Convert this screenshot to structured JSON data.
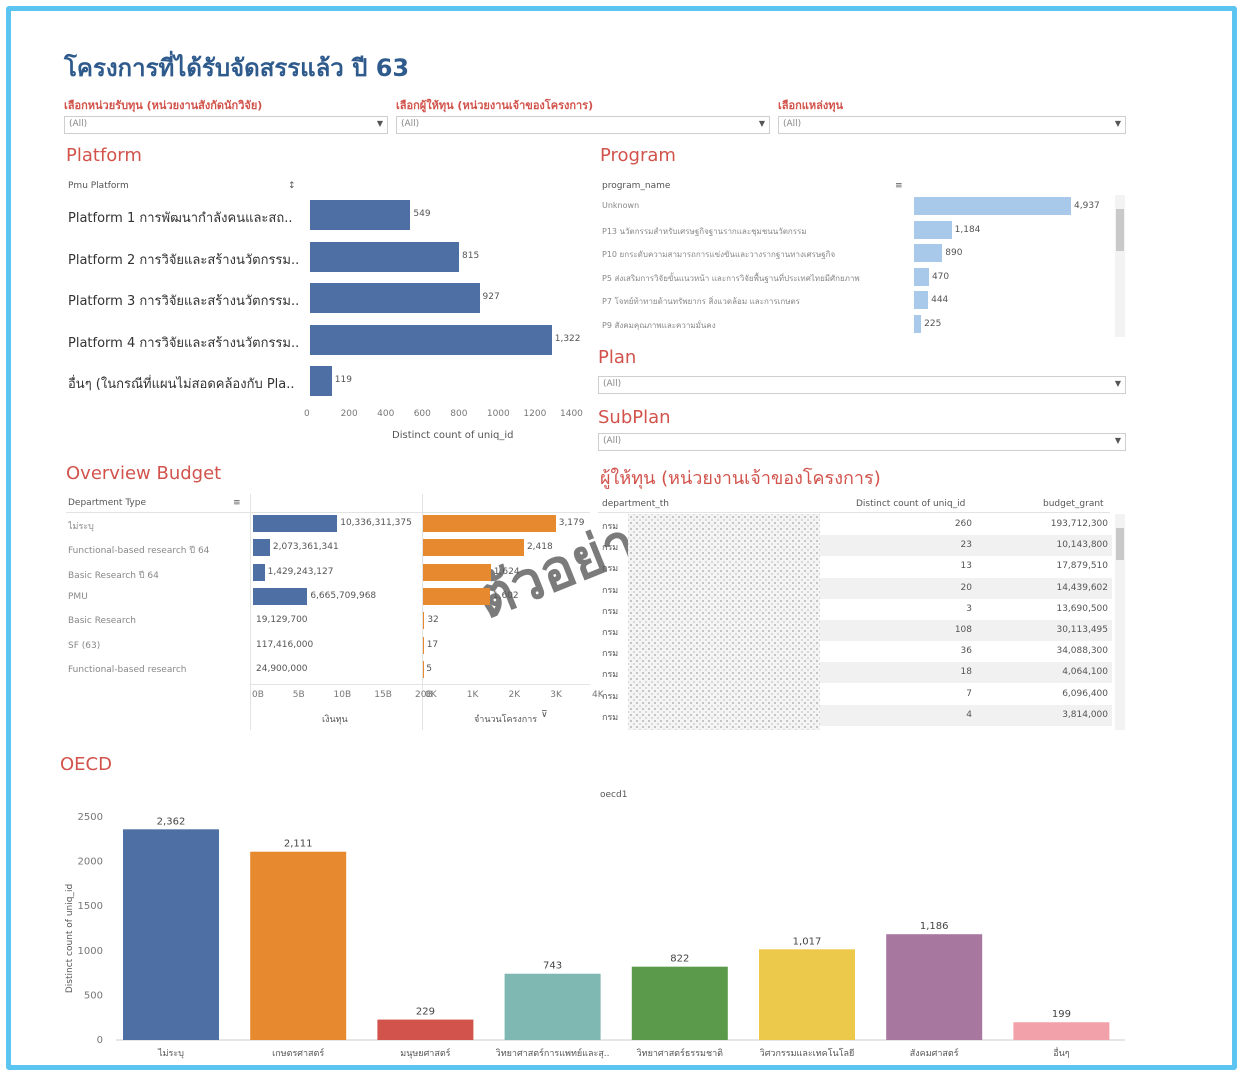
{
  "title": "โครงการที่ได้รับจัดสรรแล้ว ปี 63",
  "filters": [
    {
      "label": "เลือกหน่วยรับทุน (หน่วยงานสังกัดนักวิจัย)",
      "value": "(All)"
    },
    {
      "label": "เลือกผู้ให้ทุน (หน่วยงานเจ้าของโครงการ)",
      "value": "(All)"
    },
    {
      "label": "เลือกแหล่งทุน",
      "value": "(All)"
    }
  ],
  "platform": {
    "title": "Platform",
    "header": "Pmu Platform",
    "x_axis_label": "Distinct count of uniq_id",
    "ticks": [
      "0",
      "200",
      "400",
      "600",
      "800",
      "1000",
      "1200",
      "1400"
    ],
    "rows": [
      {
        "label": "Platform 1 การพัฒนากำลังคนและสถ..",
        "value": 549,
        "value_label": "549"
      },
      {
        "label": "Platform 2 การวิจัยและสร้างนวัตกรรม..",
        "value": 815,
        "value_label": "815"
      },
      {
        "label": "Platform 3 การวิจัยและสร้างนวัตกรรม..",
        "value": 927,
        "value_label": "927"
      },
      {
        "label": "Platform 4 การวิจัยและสร้างนวัตกรรม..",
        "value": 1322,
        "value_label": "1,322"
      },
      {
        "label": "อื่นๆ (ในกรณีที่แผนไม่สอดคล้องกับ Pla..",
        "value": 119,
        "value_label": "119"
      }
    ]
  },
  "program": {
    "title": "Program",
    "header": "program_name",
    "rows": [
      {
        "label": "Unknown",
        "value": 4937,
        "value_label": "4,937"
      },
      {
        "label": "P13 นวัตกรรมสำหรับเศรษฐกิจฐานรากและชุมชนนวัตกรรม",
        "value": 1184,
        "value_label": "1,184"
      },
      {
        "label": "P10 ยกระดับความสามารถการแข่งขันและวางรากฐานทางเศรษฐกิจ",
        "value": 890,
        "value_label": "890"
      },
      {
        "label": "P5 ส่งเสริมการวิจัยขั้นแนวหน้า และการวิจัยพื้นฐานที่ประเทศไทยมีศักยภาพ",
        "value": 470,
        "value_label": "470"
      },
      {
        "label": "P7 โจทย์ท้าทายด้านทรัพยากร สิ่งแวดล้อม และการเกษตร",
        "value": 444,
        "value_label": "444"
      },
      {
        "label": "P9 สังคมคุณภาพและความมั่นคง",
        "value": 225,
        "value_label": "225"
      }
    ]
  },
  "plan": {
    "title": "Plan",
    "value": "(All)"
  },
  "subplan": {
    "title": "SubPlan",
    "value": "(All)"
  },
  "overview": {
    "title": "Overview Budget",
    "header": "Department Type",
    "budget_axis_label": "เงินทุน",
    "count_axis_label": "จำนวนโครงการ",
    "budget_ticks": [
      "0B",
      "5B",
      "10B",
      "15B",
      "20B"
    ],
    "count_ticks": [
      "0K",
      "1K",
      "2K",
      "3K",
      "4K"
    ],
    "rows": [
      {
        "label": "ไม่ระบุ",
        "budget": 10336311375,
        "budget_label": "10,336,311,375",
        "count": 3179,
        "count_label": "3,179"
      },
      {
        "label": "Functional-based research ปี 64",
        "budget": 2073361341,
        "budget_label": "2,073,361,341",
        "count": 2418,
        "count_label": "2,418"
      },
      {
        "label": "Basic Research ปี 64",
        "budget": 1429243127,
        "budget_label": "1,429,243,127",
        "count": 1624,
        "count_label": "1,624"
      },
      {
        "label": "PMU",
        "budget": 6665709968,
        "budget_label": "6,665,709,968",
        "count": 1602,
        "count_label": "1,602"
      },
      {
        "label": "Basic Research",
        "budget": 19129700,
        "budget_label": "19,129,700",
        "count": 32,
        "count_label": "32"
      },
      {
        "label": "SF (63)",
        "budget": 117416000,
        "budget_label": "117,416,000",
        "count": 17,
        "count_label": "17"
      },
      {
        "label": "Functional-based research",
        "budget": 24900000,
        "budget_label": "24,900,000",
        "count": 5,
        "count_label": "5"
      }
    ]
  },
  "funders": {
    "title": "ผู้ให้ทุน (หน่วยงานเจ้าของโครงการ)",
    "headers": [
      "department_th",
      "Distinct count of uniq_id",
      "budget_grant"
    ],
    "rows": [
      {
        "dept": "กรม",
        "count": "260",
        "budget": "193,712,300"
      },
      {
        "dept": "กรม",
        "count": "23",
        "budget": "10,143,800"
      },
      {
        "dept": "กรม",
        "count": "13",
        "budget": "17,879,510"
      },
      {
        "dept": "กรม",
        "count": "20",
        "budget": "14,439,602"
      },
      {
        "dept": "กรม",
        "count": "3",
        "budget": "13,690,500"
      },
      {
        "dept": "กรม",
        "count": "108",
        "budget": "30,113,495"
      },
      {
        "dept": "กรม",
        "count": "36",
        "budget": "34,088,300"
      },
      {
        "dept": "กรม",
        "count": "18",
        "budget": "4,064,100"
      },
      {
        "dept": "กรม",
        "count": "7",
        "budget": "6,096,400"
      },
      {
        "dept": "กรม",
        "count": "4",
        "budget": "3,814,000"
      }
    ]
  },
  "watermark": "ตัวอย่าง",
  "colors": {
    "title": "#2e5a8c",
    "section_title": "#d2534c",
    "bar_blue": "#4e6fa3",
    "bar_light": "#a9c9ea",
    "bar_orange": "#e7892f",
    "frame": "#5bc4f0"
  },
  "chart_data": {
    "type": "bar",
    "title": "OECD",
    "subtitle": "oecd1",
    "ylabel": "Distinct count of uniq_id",
    "xlabel": "",
    "ylim": [
      0,
      2500
    ],
    "yticks": [
      0,
      500,
      1000,
      1500,
      2000,
      2500
    ],
    "categories": [
      "ไม่ระบุ",
      "เกษตรศาสตร์",
      "มนุษยศาสตร์",
      "วิทยาศาสตร์การแพทย์และสุ..",
      "วิทยาศาสตร์ธรรมชาติ",
      "วิศวกรรมและเทคโนโลยี",
      "สังคมศาสตร์",
      "อื่นๆ"
    ],
    "values": [
      2362,
      2111,
      229,
      743,
      822,
      1017,
      1186,
      199
    ],
    "value_labels": [
      "2,362",
      "2,111",
      "229",
      "743",
      "822",
      "1,017",
      "1,186",
      "199"
    ],
    "colors": [
      "#4e6fa3",
      "#e7892f",
      "#d2534c",
      "#7fb7b2",
      "#5a9a4a",
      "#ecc94b",
      "#a877a0",
      "#f2a0aa"
    ],
    "grid": false,
    "legend": "none"
  }
}
